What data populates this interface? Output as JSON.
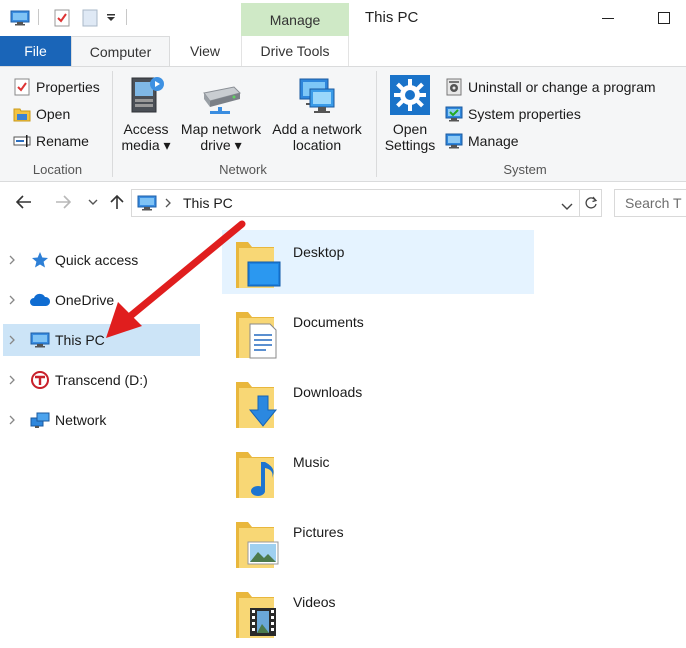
{
  "window": {
    "title": "This PC",
    "contextual_tab": "Manage"
  },
  "ribbon_tabs": {
    "file": "File",
    "computer": "Computer",
    "view": "View",
    "drive_tools": "Drive Tools"
  },
  "ribbon": {
    "location": {
      "label": "Location",
      "properties": "Properties",
      "open": "Open",
      "rename": "Rename"
    },
    "network": {
      "label": "Network",
      "access_media_line1": "Access",
      "access_media_line2": "media ▾",
      "map_drive_line1": "Map network",
      "map_drive_line2": "drive ▾",
      "add_location_line1": "Add a network",
      "add_location_line2": "location"
    },
    "system": {
      "label": "System",
      "open_settings_line1": "Open",
      "open_settings_line2": "Settings",
      "uninstall": "Uninstall or change a program",
      "system_properties": "System properties",
      "manage": "Manage"
    }
  },
  "address": {
    "path": "This PC",
    "search_placeholder": "Search T"
  },
  "nav_pane": [
    {
      "label": "Quick access",
      "icon": "star-icon"
    },
    {
      "label": "OneDrive",
      "icon": "cloud-icon"
    },
    {
      "label": "This PC",
      "icon": "computer-icon",
      "selected": true
    },
    {
      "label": "Transcend (D:)",
      "icon": "transcend-drive-icon"
    },
    {
      "label": "Network",
      "icon": "network-icon"
    }
  ],
  "folders": [
    {
      "label": "Desktop",
      "icon": "desktop-folder-icon"
    },
    {
      "label": "Documents",
      "icon": "documents-folder-icon"
    },
    {
      "label": "Downloads",
      "icon": "downloads-folder-icon"
    },
    {
      "label": "Music",
      "icon": "music-folder-icon"
    },
    {
      "label": "Pictures",
      "icon": "pictures-folder-icon"
    },
    {
      "label": "Videos",
      "icon": "videos-folder-icon"
    }
  ],
  "colors": {
    "accent": "#1a65b8",
    "selection": "#cce4f7",
    "contextual_tab": "#cfe9c6",
    "annotation_arrow": "#e01e1e"
  }
}
